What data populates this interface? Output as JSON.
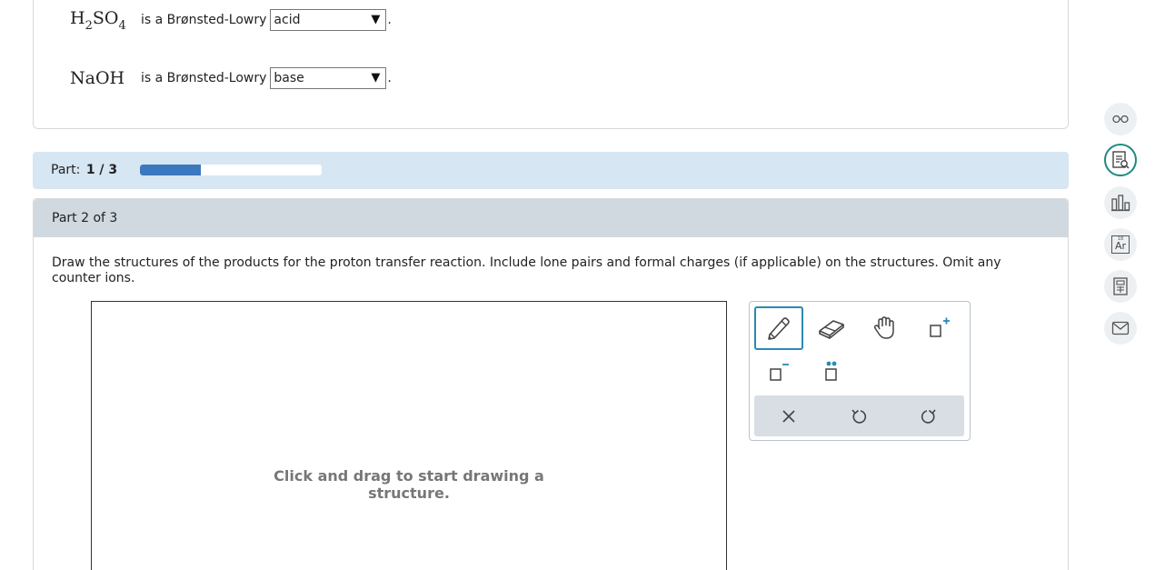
{
  "questions": [
    {
      "formula_main": "H",
      "sub1": "2",
      "mid": "SO",
      "sub2": "4",
      "text": "is a Brønsted-Lowry",
      "selected": "acid"
    },
    {
      "formula_main": "NaOH",
      "text": "is a Brønsted-Lowry",
      "selected": "base"
    }
  ],
  "period": ".",
  "progress": {
    "label": "Part:",
    "value_text": "1 / 3",
    "fraction": 0.333
  },
  "section": {
    "title": "Part 2 of 3",
    "instructions": "Draw the structures of the products for the proton transfer reaction. Include lone pairs and formal charges (if applicable) on the structures. Omit any counter ions."
  },
  "canvas": {
    "hint": "Click and drag to start drawing a structure."
  },
  "toolbox": {
    "tools": [
      "pencil-icon",
      "eraser-icon",
      "hand-icon",
      "add-positive-charge-icon",
      "add-negative-charge-icon",
      "add-lone-pair-icon"
    ],
    "actions": [
      "clear-icon",
      "undo-icon",
      "redo-icon"
    ]
  },
  "sidebar": {
    "buttons": [
      "glasses-icon",
      "worksheet-icon",
      "chart-icon",
      "periodic-table-icon",
      "calculator-icon",
      "mail-icon"
    ],
    "periodic_label": "Ar",
    "periodic_number": "18"
  },
  "colors": {
    "accent": "#2a8ab0",
    "progress_fill": "#3b78bd",
    "part_bar": "#d6e6f2",
    "section_head": "#d0d9df"
  }
}
